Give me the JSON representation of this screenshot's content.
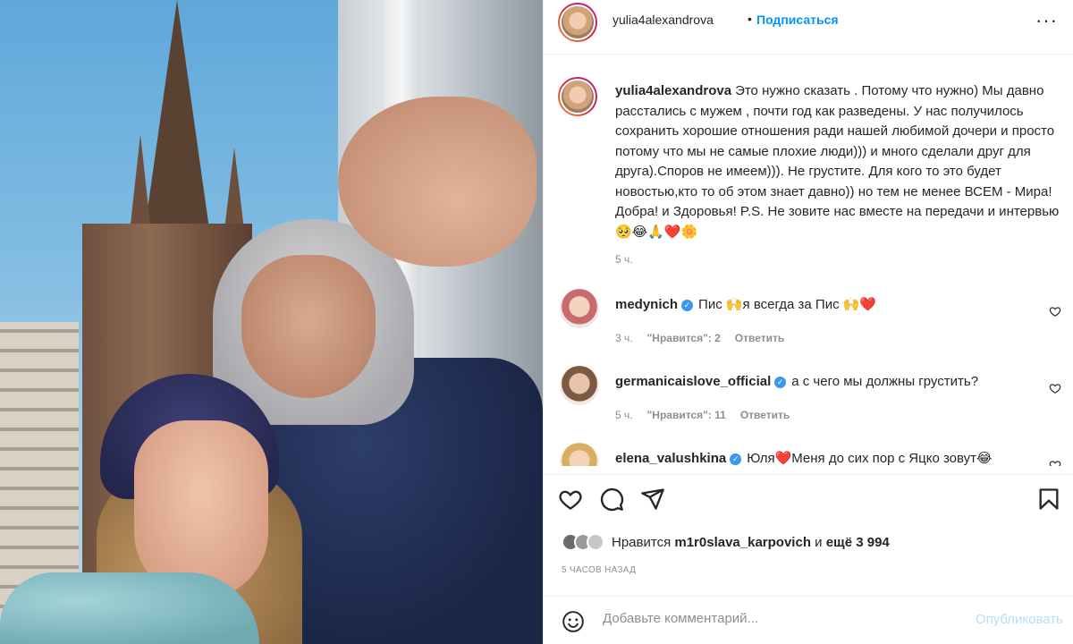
{
  "header": {
    "username": "yulia4alexandrova",
    "separator": "•",
    "follow_label": "Подписаться",
    "more_label": "···"
  },
  "caption": {
    "username": "yulia4alexandrova",
    "text": "Это нужно сказать . Потому что нужно) Мы давно расстались с мужем , почти год как разведены. У нас получилось сохранить хорошие отношения ради нашей любимой дочери и просто потому что мы не самые плохие люди))) и много сделали друг для друга).Споров не имеем))). Не грустите. Для кого то это будет новостью,кто то об этом знает давно)) но тем не менее ВСЕМ - Мира! Добра! и Здоровья! P.S. Не зовите нас вместе на передачи и интервью 🥺😂🙏❤️🌼",
    "time": "5 ч."
  },
  "comments": [
    {
      "username": "medynich",
      "verified": true,
      "text": "Пис 🙌я всегда за Пис 🙌❤️",
      "time": "3 ч.",
      "likes": "\"Нравится\": 2",
      "reply": "Ответить"
    },
    {
      "username": "germanicaislove_official",
      "verified": true,
      "text": "а с чего мы должны грустить?",
      "time": "5 ч.",
      "likes": "\"Нравится\": 11",
      "reply": "Ответить"
    },
    {
      "username": "elena_valushkina",
      "verified": true,
      "text": "Юля❤️Меня до сих пор с Яцко зовут😂",
      "time": "",
      "likes": "",
      "reply": ""
    }
  ],
  "likes": {
    "prefix": "Нравится",
    "user": "m1r0slava_karpovich",
    "middle": "и",
    "others": "ещё 3 994"
  },
  "time_ago": "5 часов назад",
  "add_comment": {
    "placeholder": "Добавьте комментарий...",
    "publish_label": "Опубликовать"
  },
  "colors": {
    "link_blue": "#0095f6",
    "verified_blue": "#3897f0",
    "muted": "#8e8e8e",
    "publish_disabled": "#b2dffc",
    "heart_red": "#ed4956"
  },
  "icons": [
    "like-icon",
    "comment-icon",
    "share-icon",
    "save-icon",
    "emoji-icon",
    "more-icon",
    "comment-like-icon",
    "verified-icon"
  ]
}
